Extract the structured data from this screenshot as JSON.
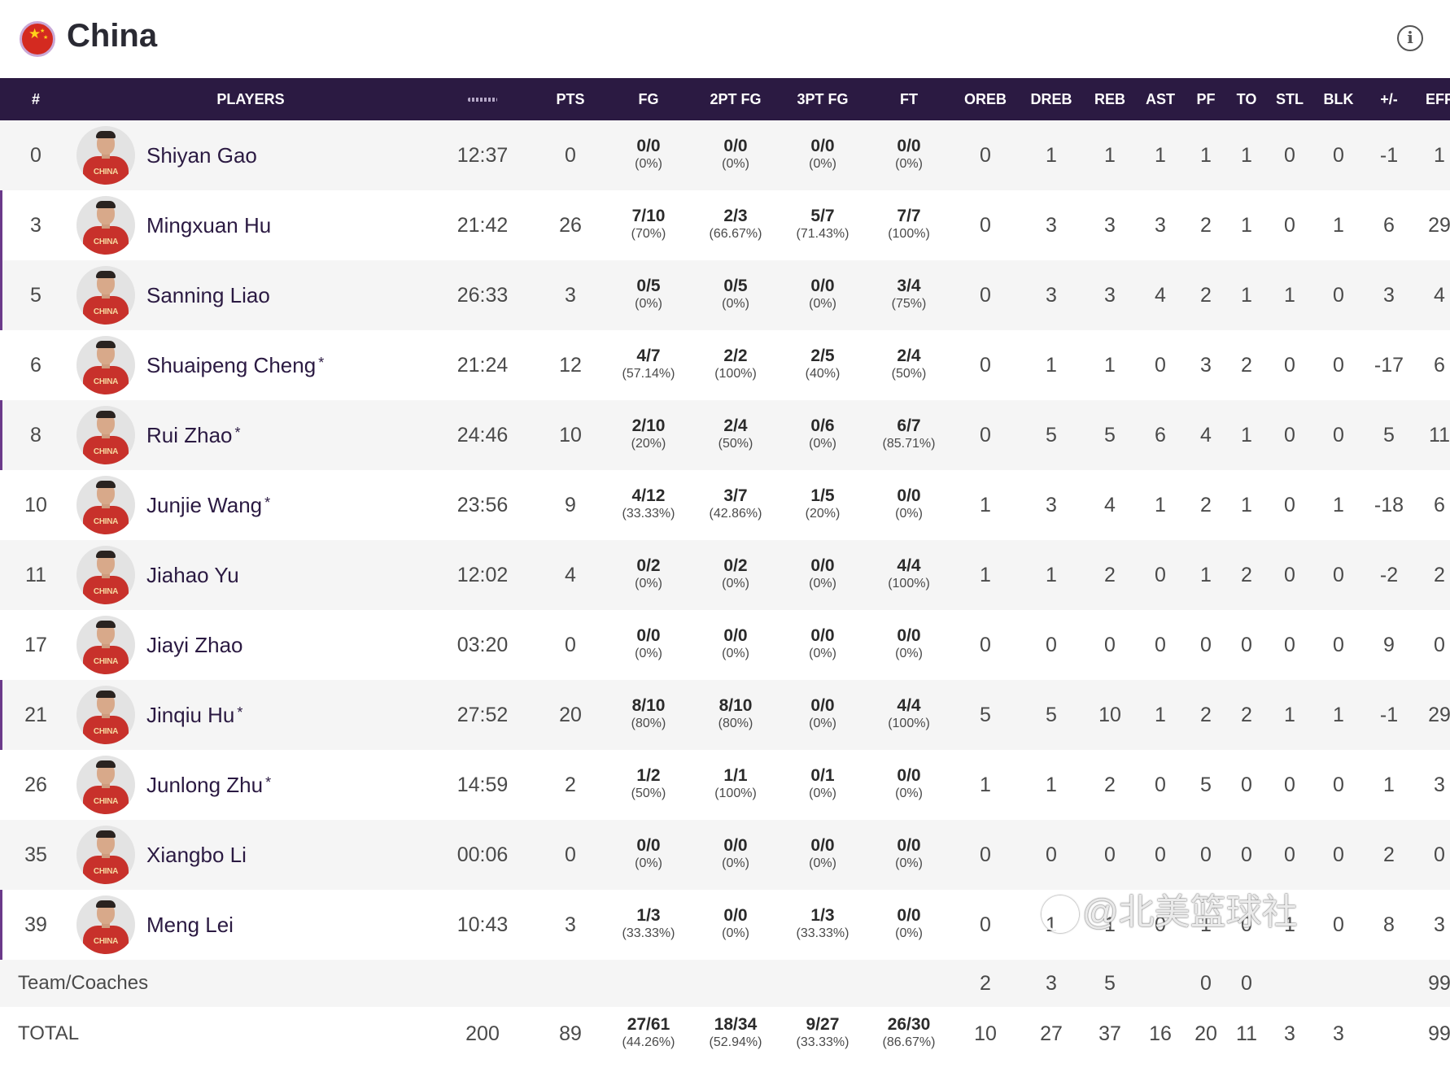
{
  "header": {
    "team": "China",
    "flag": "china-flag-icon",
    "info_icon": "i"
  },
  "columns": [
    "#",
    "PLAYERS",
    "",
    "PTS",
    "FG",
    "2PT FG",
    "3PT FG",
    "FT",
    "OREB",
    "DREB",
    "REB",
    "AST",
    "PF",
    "TO",
    "STL",
    "BLK",
    "+/-",
    "EFF"
  ],
  "colors": {
    "header_bg": "#2b1a42",
    "accent": "#6b3a8a",
    "jersey": "#c8312b"
  },
  "players": [
    {
      "num": "0",
      "name": "Shiyan Gao",
      "star": "",
      "jersey": "CHINA",
      "marked": false,
      "min": "12:37",
      "pts": "0",
      "fg": "0/0",
      "fgp": "(0%)",
      "fg2": "0/0",
      "fg2p": "(0%)",
      "fg3": "0/0",
      "fg3p": "(0%)",
      "ft": "0/0",
      "ftp": "(0%)",
      "oreb": "0",
      "dreb": "1",
      "reb": "1",
      "ast": "1",
      "pf": "1",
      "to": "1",
      "stl": "0",
      "blk": "0",
      "pm": "-1",
      "eff": "1"
    },
    {
      "num": "3",
      "name": "Mingxuan Hu",
      "star": "",
      "jersey": "CHINA",
      "marked": true,
      "min": "21:42",
      "pts": "26",
      "fg": "7/10",
      "fgp": "(70%)",
      "fg2": "2/3",
      "fg2p": "(66.67%)",
      "fg3": "5/7",
      "fg3p": "(71.43%)",
      "ft": "7/7",
      "ftp": "(100%)",
      "oreb": "0",
      "dreb": "3",
      "reb": "3",
      "ast": "3",
      "pf": "2",
      "to": "1",
      "stl": "0",
      "blk": "1",
      "pm": "6",
      "eff": "29"
    },
    {
      "num": "5",
      "name": "Sanning Liao",
      "star": "",
      "jersey": "CHINA",
      "marked": true,
      "min": "26:33",
      "pts": "3",
      "fg": "0/5",
      "fgp": "(0%)",
      "fg2": "0/5",
      "fg2p": "(0%)",
      "fg3": "0/0",
      "fg3p": "(0%)",
      "ft": "3/4",
      "ftp": "(75%)",
      "oreb": "0",
      "dreb": "3",
      "reb": "3",
      "ast": "4",
      "pf": "2",
      "to": "1",
      "stl": "1",
      "blk": "0",
      "pm": "3",
      "eff": "4"
    },
    {
      "num": "6",
      "name": "Shuaipeng Cheng",
      "star": "*",
      "jersey": "CHINA",
      "marked": false,
      "min": "21:24",
      "pts": "12",
      "fg": "4/7",
      "fgp": "(57.14%)",
      "fg2": "2/2",
      "fg2p": "(100%)",
      "fg3": "2/5",
      "fg3p": "(40%)",
      "ft": "2/4",
      "ftp": "(50%)",
      "oreb": "0",
      "dreb": "1",
      "reb": "1",
      "ast": "0",
      "pf": "3",
      "to": "2",
      "stl": "0",
      "blk": "0",
      "pm": "-17",
      "eff": "6"
    },
    {
      "num": "8",
      "name": "Rui Zhao",
      "star": "*",
      "jersey": "CHINA",
      "marked": true,
      "min": "24:46",
      "pts": "10",
      "fg": "2/10",
      "fgp": "(20%)",
      "fg2": "2/4",
      "fg2p": "(50%)",
      "fg3": "0/6",
      "fg3p": "(0%)",
      "ft": "6/7",
      "ftp": "(85.71%)",
      "oreb": "0",
      "dreb": "5",
      "reb": "5",
      "ast": "6",
      "pf": "4",
      "to": "1",
      "stl": "0",
      "blk": "0",
      "pm": "5",
      "eff": "11"
    },
    {
      "num": "10",
      "name": "Junjie Wang",
      "star": "*",
      "jersey": "CHINA",
      "marked": false,
      "min": "23:56",
      "pts": "9",
      "fg": "4/12",
      "fgp": "(33.33%)",
      "fg2": "3/7",
      "fg2p": "(42.86%)",
      "fg3": "1/5",
      "fg3p": "(20%)",
      "ft": "0/0",
      "ftp": "(0%)",
      "oreb": "1",
      "dreb": "3",
      "reb": "4",
      "ast": "1",
      "pf": "2",
      "to": "1",
      "stl": "0",
      "blk": "1",
      "pm": "-18",
      "eff": "6"
    },
    {
      "num": "11",
      "name": "Jiahao Yu",
      "star": "",
      "jersey": "CHINA",
      "marked": false,
      "min": "12:02",
      "pts": "4",
      "fg": "0/2",
      "fgp": "(0%)",
      "fg2": "0/2",
      "fg2p": "(0%)",
      "fg3": "0/0",
      "fg3p": "(0%)",
      "ft": "4/4",
      "ftp": "(100%)",
      "oreb": "1",
      "dreb": "1",
      "reb": "2",
      "ast": "0",
      "pf": "1",
      "to": "2",
      "stl": "0",
      "blk": "0",
      "pm": "-2",
      "eff": "2"
    },
    {
      "num": "17",
      "name": "Jiayi Zhao",
      "star": "",
      "jersey": "CHINA",
      "marked": false,
      "min": "03:20",
      "pts": "0",
      "fg": "0/0",
      "fgp": "(0%)",
      "fg2": "0/0",
      "fg2p": "(0%)",
      "fg3": "0/0",
      "fg3p": "(0%)",
      "ft": "0/0",
      "ftp": "(0%)",
      "oreb": "0",
      "dreb": "0",
      "reb": "0",
      "ast": "0",
      "pf": "0",
      "to": "0",
      "stl": "0",
      "blk": "0",
      "pm": "9",
      "eff": "0"
    },
    {
      "num": "21",
      "name": "Jinqiu Hu",
      "star": "*",
      "jersey": "CHINA",
      "marked": true,
      "min": "27:52",
      "pts": "20",
      "fg": "8/10",
      "fgp": "(80%)",
      "fg2": "8/10",
      "fg2p": "(80%)",
      "fg3": "0/0",
      "fg3p": "(0%)",
      "ft": "4/4",
      "ftp": "(100%)",
      "oreb": "5",
      "dreb": "5",
      "reb": "10",
      "ast": "1",
      "pf": "2",
      "to": "2",
      "stl": "1",
      "blk": "1",
      "pm": "-1",
      "eff": "29"
    },
    {
      "num": "26",
      "name": "Junlong Zhu",
      "star": "*",
      "jersey": "CHINA",
      "marked": false,
      "min": "14:59",
      "pts": "2",
      "fg": "1/2",
      "fgp": "(50%)",
      "fg2": "1/1",
      "fg2p": "(100%)",
      "fg3": "0/1",
      "fg3p": "(0%)",
      "ft": "0/0",
      "ftp": "(0%)",
      "oreb": "1",
      "dreb": "1",
      "reb": "2",
      "ast": "0",
      "pf": "5",
      "to": "0",
      "stl": "0",
      "blk": "0",
      "pm": "1",
      "eff": "3"
    },
    {
      "num": "35",
      "name": "Xiangbo Li",
      "star": "",
      "jersey": "CHINA",
      "marked": false,
      "min": "00:06",
      "pts": "0",
      "fg": "0/0",
      "fgp": "(0%)",
      "fg2": "0/0",
      "fg2p": "(0%)",
      "fg3": "0/0",
      "fg3p": "(0%)",
      "ft": "0/0",
      "ftp": "(0%)",
      "oreb": "0",
      "dreb": "0",
      "reb": "0",
      "ast": "0",
      "pf": "0",
      "to": "0",
      "stl": "0",
      "blk": "0",
      "pm": "2",
      "eff": "0"
    },
    {
      "num": "39",
      "name": "Meng Lei",
      "star": "",
      "jersey": "CHINA",
      "marked": true,
      "min": "10:43",
      "pts": "3",
      "fg": "1/3",
      "fgp": "(33.33%)",
      "fg2": "0/0",
      "fg2p": "(0%)",
      "fg3": "1/3",
      "fg3p": "(33.33%)",
      "ft": "0/0",
      "ftp": "(0%)",
      "oreb": "0",
      "dreb": "1",
      "reb": "1",
      "ast": "0",
      "pf": "1",
      "to": "0",
      "stl": "1",
      "blk": "0",
      "pm": "8",
      "eff": "3"
    }
  ],
  "team_row": {
    "label": "Team/Coaches",
    "oreb": "2",
    "dreb": "3",
    "reb": "5",
    "pf": "0",
    "to": "0",
    "eff": "99"
  },
  "total_row": {
    "label": "TOTAL",
    "min": "200",
    "pts": "89",
    "fg": "27/61",
    "fgp": "(44.26%)",
    "fg2": "18/34",
    "fg2p": "(52.94%)",
    "fg3": "9/27",
    "fg3p": "(33.33%)",
    "ft": "26/30",
    "ftp": "(86.67%)",
    "oreb": "10",
    "dreb": "27",
    "reb": "37",
    "ast": "16",
    "pf": "20",
    "to": "11",
    "stl": "3",
    "blk": "3",
    "eff": "99"
  },
  "watermark": "@北美篮球社"
}
